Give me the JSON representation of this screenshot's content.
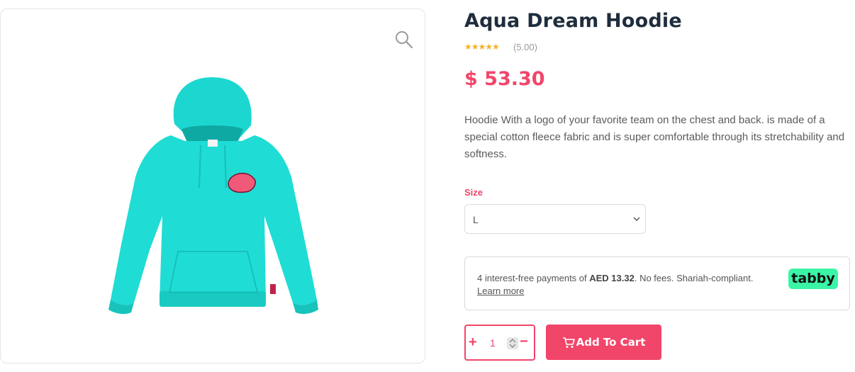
{
  "product": {
    "title": "Aqua Dream Hoodie",
    "stars": "★★★★★",
    "rating": "(5.00)",
    "price": "$ 53.30",
    "description": "Hoodie With a logo of your favorite team on the chest and back. is made of a special cotton fleece fabric and is super comfortable through its stretchability and softness.",
    "image_icon": "zoom-icon"
  },
  "size": {
    "label": "Size",
    "selected": "L"
  },
  "tabby": {
    "text_prefix": "4 interest-free payments of ",
    "amount": "AED 13.32",
    "text_suffix": ". No fees. Shariah-compliant.",
    "learn_more": "Learn more",
    "logo": "tabby",
    "logo_color": "#3bf5a7"
  },
  "cart": {
    "quantity": "1",
    "plus": "+",
    "minus": "−",
    "add_label": "Add To Cart",
    "accent": "#f2456a"
  }
}
